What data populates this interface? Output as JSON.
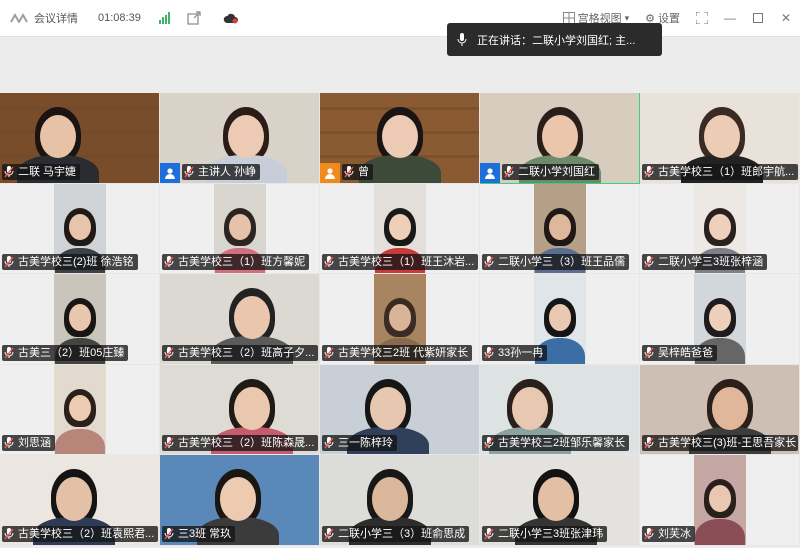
{
  "titlebar": {
    "app_title": "会议详情",
    "elapsed_time": "01:08:39",
    "view_mode": "宫格视图",
    "settings_label": "设置"
  },
  "speaking_banner": {
    "text": "正在讲话：二联小学刘国红; 主..."
  },
  "participants": [
    {
      "name": "二联 马宇婕",
      "badge": null
    },
    {
      "name": "主讲人 孙峥",
      "badge": "host"
    },
    {
      "name": "曾",
      "badge": "cohost"
    },
    {
      "name": "二联小学刘国红",
      "badge": "host",
      "active": true
    },
    {
      "name": "古美学校三（1）班郎宇航...",
      "badge": null
    },
    {
      "name": "古美学校三(2)班 徐浩铭",
      "badge": null
    },
    {
      "name": "古美学校三（1）班方馨妮",
      "badge": null
    },
    {
      "name": "古美学校三（1）班王沐岩...",
      "badge": null
    },
    {
      "name": "二联小学三（3）班王品儒",
      "badge": null
    },
    {
      "name": "二联小学三3班张梓涵",
      "badge": null
    },
    {
      "name": "古美三（2）班05庄臻",
      "badge": null
    },
    {
      "name": "古美学校三（2）班高子夕...",
      "badge": null
    },
    {
      "name": "古美学校三2班 代紫妍家长",
      "badge": null
    },
    {
      "name": "33孙一冉",
      "badge": null
    },
    {
      "name": "吴梓皓爸爸",
      "badge": null
    },
    {
      "name": "刘思涵",
      "badge": null
    },
    {
      "name": "古美学校三（2）班陈森晟...",
      "badge": null
    },
    {
      "name": "三一陈梓玲",
      "badge": null
    },
    {
      "name": "古美学校三2班邹乐馨家长",
      "badge": null
    },
    {
      "name": "古美学校三(3)班-王思吾家长",
      "badge": null
    },
    {
      "name": "古美学校三（2）班袁熙君...",
      "badge": null
    },
    {
      "name": "三3班 常玖",
      "badge": null
    },
    {
      "name": "二联小学三（3）班俞思成",
      "badge": null
    },
    {
      "name": "二联小学三3班张津玮",
      "badge": null
    },
    {
      "name": "刘芙冰",
      "badge": null
    }
  ],
  "colors": {
    "active_border": "#3fcf7a",
    "host_badge": "#1e6fd9",
    "cohost_badge": "#f08a1d"
  }
}
